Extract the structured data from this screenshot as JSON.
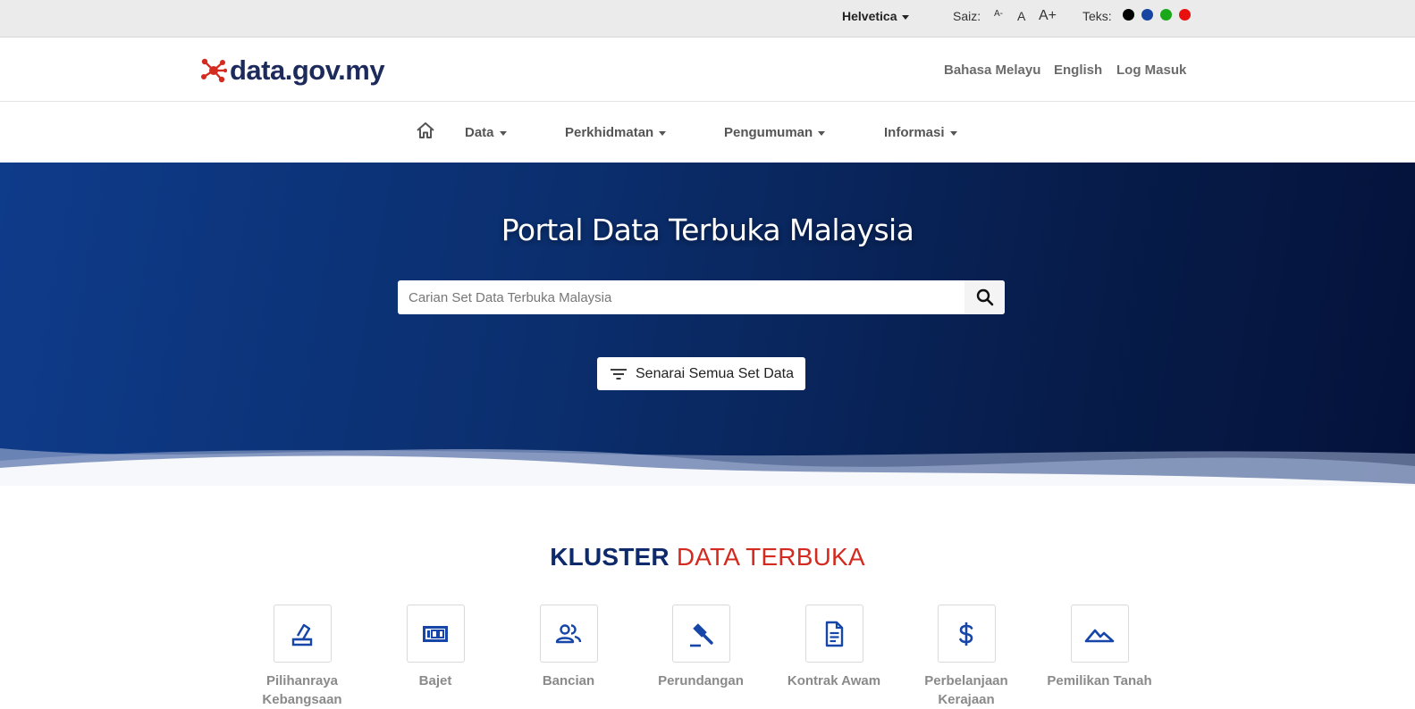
{
  "topbar": {
    "font_name": "Helvetica",
    "size_label": "Saiz:",
    "size_small": "A-",
    "size_normal": "A",
    "size_large": "A+",
    "text_label": "Teks:",
    "text_colors": [
      "#000000",
      "#1746a2",
      "#1aa81a",
      "#e8110f"
    ]
  },
  "header": {
    "logo_text": "data.gov.my",
    "links": [
      "Bahasa Melayu",
      "English",
      "Log Masuk"
    ]
  },
  "nav": {
    "items": [
      "Data",
      "Perkhidmatan",
      "Pengumuman",
      "Informasi"
    ]
  },
  "hero": {
    "title": "Portal Data Terbuka Malaysia",
    "search_placeholder": "Carian Set Data Terbuka Malaysia",
    "list_button": "Senarai Semua Set Data"
  },
  "section": {
    "title_part1": "KLUSTER",
    "title_part2": "DATA TERBUKA"
  },
  "clusters": [
    {
      "label": "Pilihanraya Kebangsaan",
      "icon": "ballot-icon"
    },
    {
      "label": "Bajet",
      "icon": "budget-icon"
    },
    {
      "label": "Bancian",
      "icon": "people-icon"
    },
    {
      "label": "Perundangan",
      "icon": "gavel-icon"
    },
    {
      "label": "Kontrak Awam",
      "icon": "document-icon"
    },
    {
      "label": "Perbelanjaan Kerajaan",
      "icon": "dollar-icon"
    },
    {
      "label": "Pemilikan Tanah",
      "icon": "landscape-icon"
    }
  ],
  "colors": {
    "brand_dark": "#0e2a6b",
    "brand_red": "#d42b21",
    "icon_blue": "#1646a8"
  }
}
